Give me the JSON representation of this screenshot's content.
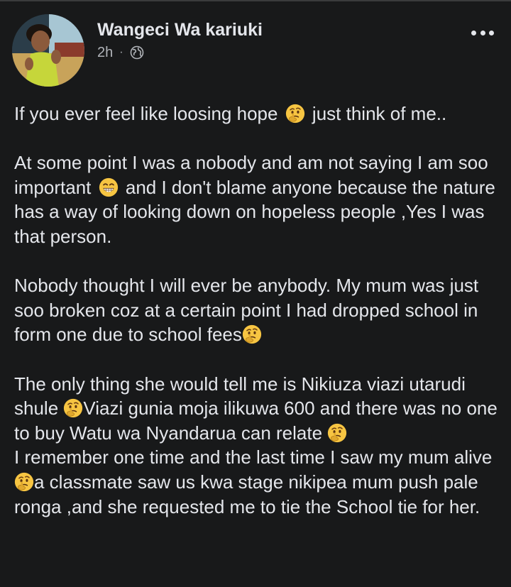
{
  "post": {
    "author": "Wangeci Wa kariuki",
    "time": "2h",
    "separator": "·",
    "privacy_icon": "globe-icon",
    "menu_icon": "more-options-icon"
  },
  "body": {
    "p1_a": "If you ever feel like loosing hope",
    "p1_b": "just think of me..",
    "p2_a": "At some point I was a nobody and am not saying I am soo important",
    "p2_b": "and  I don't blame anyone because the nature has a way of looking down on hopeless people ,Yes I was that person.",
    "p3_a": "Nobody thought I will ever be anybody. My mum was just soo broken coz at a certain point I had dropped school in  form one due to school fees",
    "p4_a": "The only thing she would tell me is Nikiuza viazi utarudi shule",
    "p4_b": "Viazi gunia moja ilikuwa 600 and there was no one to buy Watu wa Nyandarua can relate",
    "p5_a": "I remember one time and the last time I saw my mum alive",
    "p5_b": "a classmate saw us kwa stage nikipea mum push pale ronga ,and she requested me to tie the School tie for her."
  },
  "emojis": {
    "thinking": "thinking-face-emoji",
    "grin": "grinning-face-emoji"
  },
  "colors": {
    "background": "#18191a",
    "text": "#e4e6eb",
    "secondary": "#b0b3b8",
    "emoji_yellow": "#f7c542"
  }
}
